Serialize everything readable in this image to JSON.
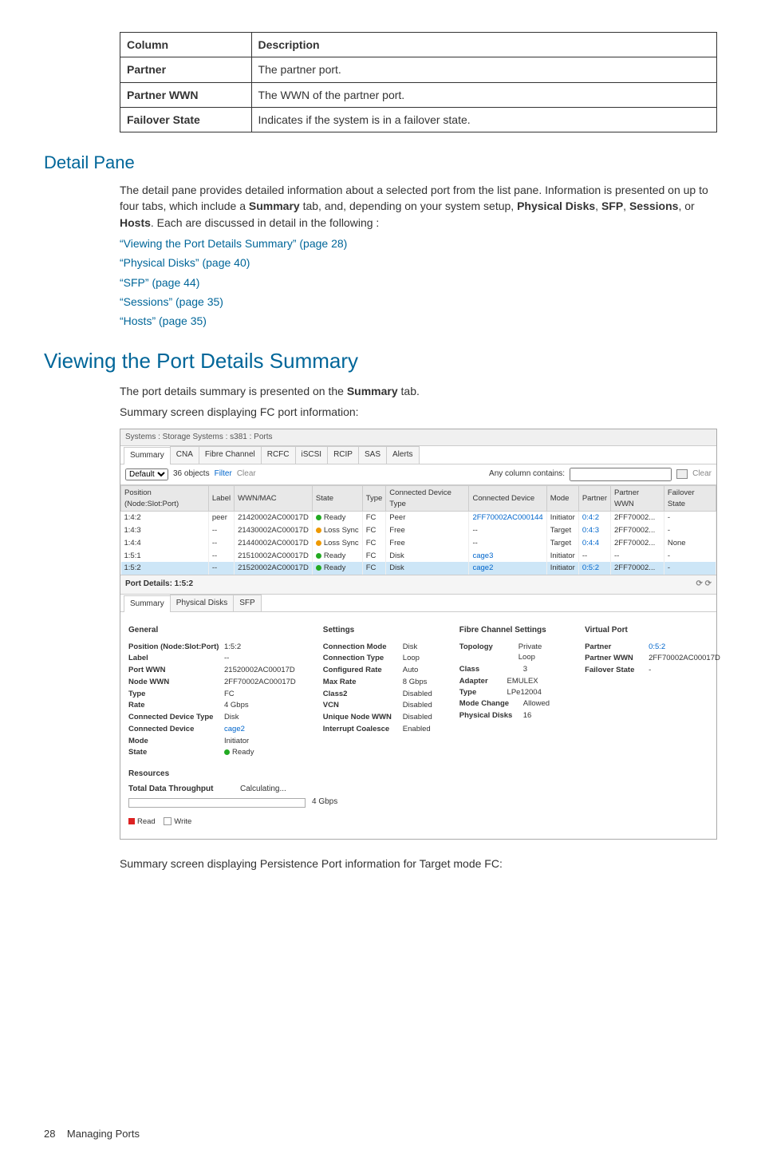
{
  "defs_table": {
    "headers": [
      "Column",
      "Description"
    ],
    "rows": [
      [
        "Partner",
        "The partner port."
      ],
      [
        "Partner WWN",
        "The WWN of the partner port."
      ],
      [
        "Failover State",
        "Indicates if the system is in a failover state."
      ]
    ]
  },
  "section_detail_pane": "Detail Pane",
  "detail_pane_para": {
    "pre": "The detail pane provides detailed information about a selected port from the list pane. Information is presented on up to four tabs, which include a ",
    "b1": "Summary",
    "mid1": " tab, and, depending on your system setup, ",
    "b2": "Physical Disks",
    "c1": ", ",
    "b3": "SFP",
    "c2": ", ",
    "b4": "Sessions",
    "c3": ", or ",
    "b5": "Hosts",
    "post": ". Each are discussed in detail in the following :"
  },
  "detail_links": [
    "“Viewing the Port Details Summary” (page 28)",
    "“Physical Disks” (page 40)",
    "“SFP” (page 44)",
    "“Sessions” (page 35)",
    "“Hosts” (page 35)"
  ],
  "heading_main": "Viewing the Port Details Summary",
  "summary_intro_pre": "The port details summary is presented on the ",
  "summary_intro_bold": "Summary",
  "summary_intro_post": " tab.",
  "summary_caption": "Summary screen displaying FC port information:",
  "screenshot": {
    "breadcrumb": "Systems : Storage Systems : s381 : Ports",
    "main_tabs": [
      "Summary",
      "CNA",
      "Fibre Channel",
      "RCFC",
      "iSCSI",
      "RCIP",
      "SAS",
      "Alerts"
    ],
    "active_main_tab": 0,
    "toolbar": {
      "dropdown": "Default",
      "objects": "36 objects",
      "filter_label": "Filter",
      "clear_label": "Clear",
      "any_column": "Any column contains:",
      "clear_btn": "Clear"
    },
    "port_headers": [
      "Position (Node:Slot:Port)",
      "Label",
      "WWN/MAC",
      "State",
      "Type",
      "Connected Device Type",
      "Connected Device",
      "Mode",
      "Partner",
      "Partner WWN",
      "Failover State"
    ],
    "port_rows": [
      {
        "pos": "1:4:2",
        "label": "peer",
        "wwn": "21420002AC00017D",
        "state": "Ready",
        "stateColor": "green",
        "type": "FC",
        "cdt": "Peer",
        "cd": "2FF70002AC000144",
        "mode": "Initiator",
        "partner": "0:4:2",
        "pwwn": "2FF70002...",
        "fail": "-",
        "sel": false
      },
      {
        "pos": "1:4:3",
        "label": "--",
        "wwn": "21430002AC00017D",
        "state": "Loss Sync",
        "stateColor": "orange",
        "type": "FC",
        "cdt": "Free",
        "cd": "--",
        "mode": "Target",
        "partner": "0:4:3",
        "pwwn": "2FF70002...",
        "fail": "-",
        "sel": false
      },
      {
        "pos": "1:4:4",
        "label": "--",
        "wwn": "21440002AC00017D",
        "state": "Loss Sync",
        "stateColor": "orange",
        "type": "FC",
        "cdt": "Free",
        "cd": "--",
        "mode": "Target",
        "partner": "0:4:4",
        "pwwn": "2FF70002...",
        "fail": "None",
        "sel": false
      },
      {
        "pos": "1:5:1",
        "label": "--",
        "wwn": "21510002AC00017D",
        "state": "Ready",
        "stateColor": "green",
        "type": "FC",
        "cdt": "Disk",
        "cd": "cage3",
        "mode": "Initiator",
        "partner": "--",
        "pwwn": "--",
        "fail": "-",
        "sel": false
      },
      {
        "pos": "1:5:2",
        "label": "--",
        "wwn": "21520002AC00017D",
        "state": "Ready",
        "stateColor": "green",
        "type": "FC",
        "cdt": "Disk",
        "cd": "cage2",
        "mode": "Initiator",
        "partner": "0:5:2",
        "pwwn": "2FF70002...",
        "fail": "-",
        "sel": true
      }
    ],
    "detail_title": "Port Details: 1:5:2",
    "detail_tabs": [
      "Summary",
      "Physical Disks",
      "SFP"
    ],
    "active_detail_tab": 0,
    "general": {
      "heading": "General",
      "items": [
        [
          "Position (Node:Slot:Port)",
          "1:5:2"
        ],
        [
          "Label",
          "--"
        ],
        [
          "Port WWN",
          "21520002AC00017D"
        ],
        [
          "Node WWN",
          "2FF70002AC00017D"
        ],
        [
          "Type",
          "FC"
        ],
        [
          "Rate",
          "4 Gbps"
        ],
        [
          "Connected Device Type",
          "Disk"
        ],
        [
          "Connected Device",
          "cage2"
        ],
        [
          "Mode",
          "Initiator"
        ],
        [
          "State",
          "Ready"
        ]
      ],
      "state_dot": "green",
      "cd_link": true
    },
    "settings": {
      "heading": "Settings",
      "items": [
        [
          "Connection Mode",
          "Disk"
        ],
        [
          "Connection Type",
          "Loop"
        ],
        [
          "Configured Rate",
          "Auto"
        ],
        [
          "Max Rate",
          "8 Gbps"
        ],
        [
          "Class2",
          "Disabled"
        ],
        [
          "VCN",
          "Disabled"
        ],
        [
          "Unique Node WWN",
          "Disabled"
        ],
        [
          "Interrupt Coalesce",
          "Enabled"
        ]
      ]
    },
    "fc": {
      "heading": "Fibre Channel Settings",
      "items": [
        [
          "Topology",
          "Private Loop"
        ],
        [
          "Class",
          "3"
        ],
        [
          "Adapter Type",
          "EMULEX LPe12004"
        ],
        [
          "Mode Change",
          "Allowed"
        ],
        [
          "Physical Disks",
          "16"
        ]
      ]
    },
    "vp": {
      "heading": "Virtual Port",
      "items": [
        [
          "Partner",
          "0:5:2"
        ],
        [
          "Partner WWN",
          "2FF70002AC00017D"
        ],
        [
          "Failover State",
          "-"
        ]
      ]
    },
    "resources": {
      "heading": "Resources",
      "tdt_label": "Total Data Throughput",
      "tdt_value": "Calculating...",
      "scale": "4 Gbps",
      "legend_read": "Read",
      "legend_write": "Write"
    }
  },
  "caption_persistence": "Summary screen displaying Persistence Port information for Target mode FC:",
  "footer_page": "28",
  "footer_title": "Managing Ports"
}
